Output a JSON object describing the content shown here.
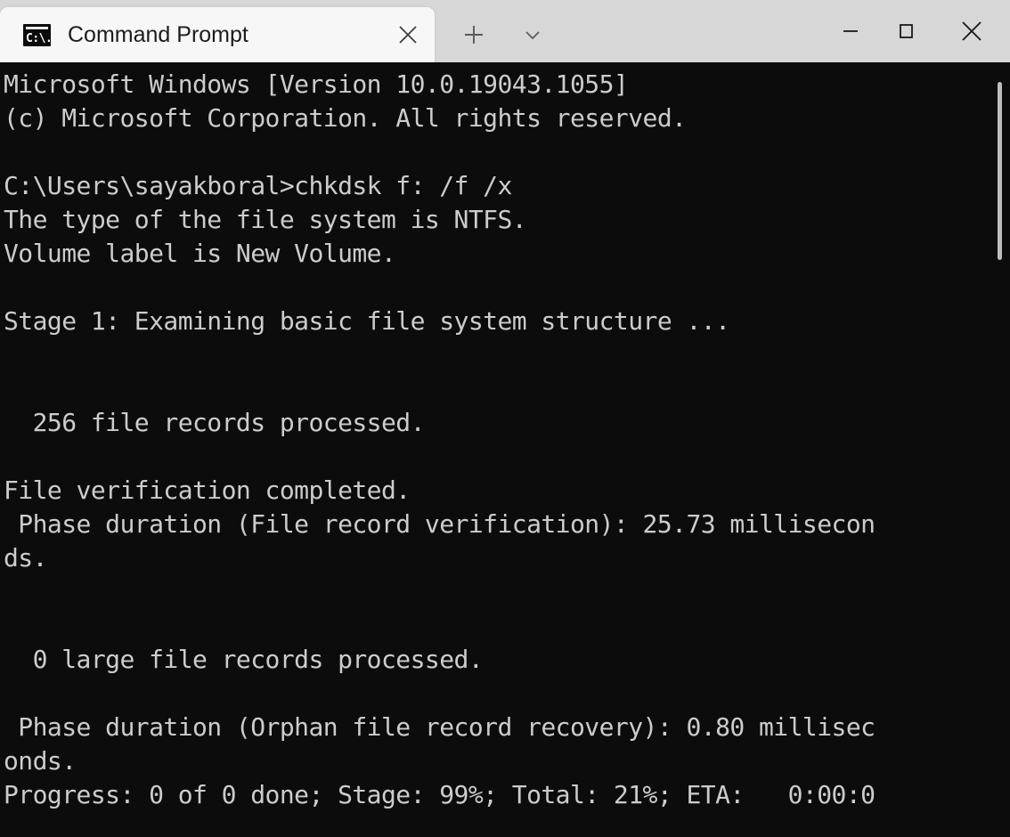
{
  "window": {
    "title": "Command Prompt",
    "tab": {
      "icon_name": "command-prompt-icon",
      "icon_glyph": "C:\\.",
      "label": "Command Prompt",
      "close_glyph": "✕"
    },
    "toolbar": {
      "new_tab_glyph": "＋",
      "new_tab_label": "New tab",
      "dropdown_glyph": "⌄",
      "dropdown_label": "Open new tab dropdown"
    },
    "controls": {
      "minimize_glyph": "─",
      "minimize_label": "Minimize",
      "maximize_glyph": "☐",
      "maximize_label": "Maximize",
      "close_glyph": "✕",
      "close_label": "Close"
    },
    "colors": {
      "titlebar_bg": "#d7d7d7",
      "tab_bg": "#f7f7f7",
      "terminal_bg": "#0c0c0c",
      "terminal_fg": "#cccccc",
      "scrollbar_thumb": "#bdbdbd"
    }
  },
  "terminal": {
    "command": "chkdsk f: /f /x",
    "prompt": "C:\\Users\\sayakboral>",
    "user": "sayakboral",
    "os_version": "10.0.19043.1055",
    "file_system": "NTFS",
    "volume_label": "New Volume",
    "stage": "Stage 1: Examining basic file system structure ...",
    "file_records_processed": "256",
    "large_file_records_processed": "0",
    "file_record_verification_ms": "25.73",
    "orphan_file_record_recovery_ms": "0.80",
    "progress": {
      "done": "0",
      "of": "0",
      "stage_percent": "99%",
      "total_percent": "21%",
      "eta": "0:00:0"
    },
    "lines": [
      "Microsoft Windows [Version 10.0.19043.1055]",
      "(c) Microsoft Corporation. All rights reserved.",
      "",
      "C:\\Users\\sayakboral>chkdsk f: /f /x",
      "The type of the file system is NTFS.",
      "Volume label is New Volume.",
      "",
      "Stage 1: Examining basic file system structure ...",
      "",
      "",
      "  256 file records processed.",
      "",
      "File verification completed.",
      " Phase duration (File record verification): 25.73 millisecon",
      "ds.",
      "",
      "",
      "  0 large file records processed.",
      "",
      " Phase duration (Orphan file record recovery): 0.80 millisec",
      "onds.",
      "Progress: 0 of 0 done; Stage: 99%; Total: 21%; ETA:   0:00:0"
    ]
  }
}
